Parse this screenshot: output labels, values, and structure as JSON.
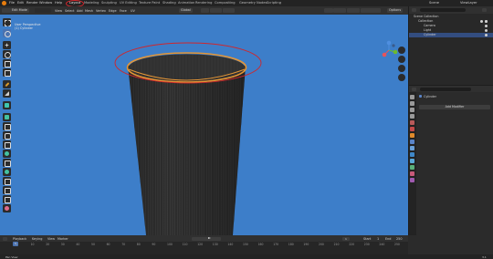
{
  "menu_bar": {
    "items": [
      "File",
      "Edit",
      "Render",
      "Window",
      "Help"
    ],
    "workspaces": [
      "Layout",
      "Modeling",
      "Sculpting",
      "UV Editing",
      "Texture Paint",
      "Shading",
      "Animation",
      "Rendering",
      "Compositing",
      "Geometry Nodes",
      "Scripting"
    ],
    "active_workspace": "Layout",
    "scene_label": "Scene",
    "view_layer_label": "ViewLayer"
  },
  "viewport_header": {
    "mode": "Edit Mode",
    "menus": [
      "View",
      "Select",
      "Add",
      "Mesh",
      "Vertex",
      "Edge",
      "Face",
      "UV"
    ],
    "orientation": "Global",
    "options_label": "Options"
  },
  "viewport": {
    "overlay_line1": "User Perspective",
    "overlay_line2": "(1) Cylinder",
    "background_color": "#3d7ec9"
  },
  "outliner": {
    "rows": [
      {
        "label": "Scene Collection",
        "selected": false
      },
      {
        "label": "Collection",
        "selected": false
      },
      {
        "label": "Camera",
        "selected": false
      },
      {
        "label": "Light",
        "selected": false
      },
      {
        "label": "Cylinder",
        "selected": true
      }
    ]
  },
  "properties": {
    "object_name": "Cylinder",
    "add_modifier_label": "Add Modifier"
  },
  "timeline": {
    "menus": [
      "Playback",
      "Keying",
      "View",
      "Marker"
    ],
    "start_label": "Start",
    "start_value": "1",
    "end_label": "End",
    "end_value": "250",
    "current_frame": "1",
    "ticks": [
      "0",
      "10",
      "20",
      "30",
      "40",
      "50",
      "60",
      "70",
      "80",
      "90",
      "100",
      "110",
      "120",
      "130",
      "140",
      "150",
      "160",
      "170",
      "180",
      "190",
      "200",
      "210",
      "220",
      "230",
      "240",
      "250"
    ]
  },
  "status_bar": {
    "left": "Pan View",
    "right": "3.1"
  }
}
